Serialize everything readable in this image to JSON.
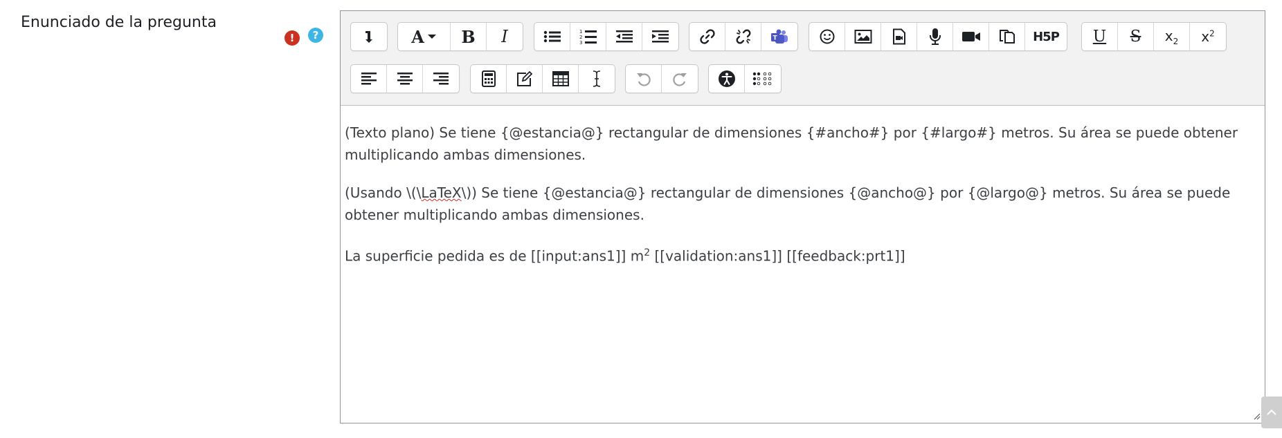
{
  "field": {
    "label": "Enunciado de la pregunta",
    "required_icon": "exclamation-icon",
    "help_icon": "question-icon"
  },
  "toolbar": {
    "row1": [
      {
        "name": "collapse-toggle-button",
        "icon": "collapse-icon"
      },
      {
        "name": "paragraph-style-button",
        "icon": "font-style-icon"
      },
      {
        "name": "bold-button",
        "icon": "bold-icon"
      },
      {
        "name": "italic-button",
        "icon": "italic-icon"
      },
      {
        "name": "unordered-list-button",
        "icon": "bullet-list-icon"
      },
      {
        "name": "ordered-list-button",
        "icon": "numbered-list-icon"
      },
      {
        "name": "outdent-button",
        "icon": "outdent-icon"
      },
      {
        "name": "indent-button",
        "icon": "indent-icon"
      },
      {
        "name": "link-button",
        "icon": "link-icon"
      },
      {
        "name": "unlink-button",
        "icon": "unlink-icon"
      },
      {
        "name": "teams-meeting-button",
        "icon": "teams-icon"
      },
      {
        "name": "emoji-button",
        "icon": "emoji-icon"
      },
      {
        "name": "image-button",
        "icon": "image-icon"
      },
      {
        "name": "media-button",
        "icon": "media-file-icon"
      },
      {
        "name": "record-audio-button",
        "icon": "microphone-icon"
      },
      {
        "name": "record-video-button",
        "icon": "video-camera-icon"
      },
      {
        "name": "manage-files-button",
        "icon": "copy-files-icon"
      },
      {
        "name": "h5p-button",
        "icon": "h5p-icon",
        "label": "H5P"
      },
      {
        "name": "underline-button",
        "icon": "underline-icon"
      },
      {
        "name": "strikethrough-button",
        "icon": "strikethrough-icon"
      },
      {
        "name": "subscript-button",
        "icon": "subscript-icon"
      },
      {
        "name": "superscript-button",
        "icon": "superscript-icon"
      }
    ],
    "row2": [
      {
        "name": "align-left-button",
        "icon": "align-left-icon"
      },
      {
        "name": "align-center-button",
        "icon": "align-center-icon"
      },
      {
        "name": "align-right-button",
        "icon": "align-right-icon"
      },
      {
        "name": "equation-button",
        "icon": "calculator-icon"
      },
      {
        "name": "special-character-button",
        "icon": "edit-icon"
      },
      {
        "name": "table-button",
        "icon": "table-icon"
      },
      {
        "name": "clear-formatting-button",
        "icon": "text-cursor-icon"
      },
      {
        "name": "undo-button",
        "icon": "undo-icon"
      },
      {
        "name": "redo-button",
        "icon": "redo-icon"
      },
      {
        "name": "accessibility-checker-button",
        "icon": "accessibility-icon"
      },
      {
        "name": "screenreader-helper-button",
        "icon": "braille-icon"
      }
    ]
  },
  "content": {
    "p1": "(Texto plano) Se tiene {@estancia@} rectangular de dimensiones {#ancho#} por {#largo#} metros. Su área se puede obtener multiplicando ambas dimensiones.",
    "p2_before": "(Usando \\(\\",
    "p2_misspelled": "LaTeX",
    "p2_after": "\\)) Se tiene {@estancia@} rectangular de dimensiones {@ancho@} por {@largo@} metros. Su área se puede obtener multiplicando ambas dimensiones.",
    "p3_before": "La superficie pedida es de [[input:ans1]] m",
    "p3_sup": "2",
    "p3_after": " [[validation:ans1]] [[feedback:prt1]]"
  },
  "labels": {
    "bold": "B",
    "italic": "I",
    "font": "A",
    "h5p": "H5P",
    "underline": "U",
    "strike": "S",
    "sub_base": "x",
    "sub_idx": "2",
    "sup_base": "x",
    "sup_idx": "2",
    "req_mark": "!",
    "help_mark": "?"
  },
  "colors": {
    "required": "#ca3120",
    "help": "#3db6e6",
    "teams": "#5059c9",
    "toolbar_bg": "#f2f2f2"
  }
}
